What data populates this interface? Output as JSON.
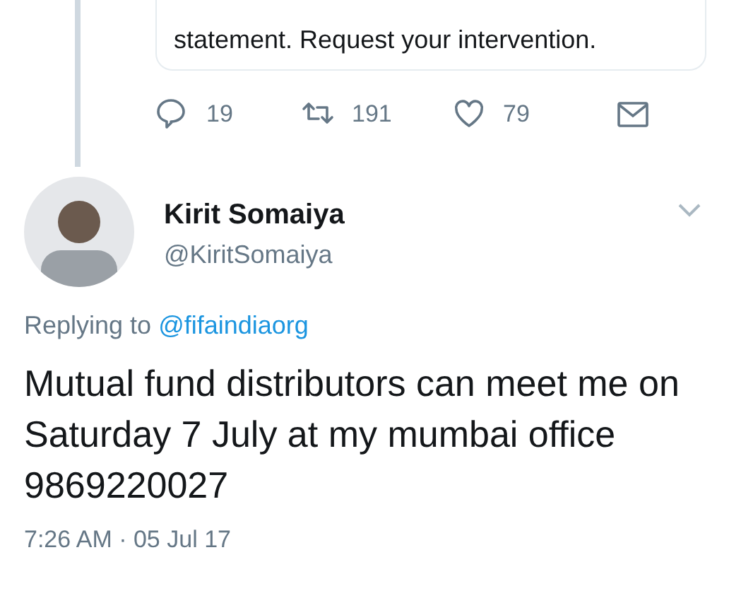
{
  "quoted_tweet": {
    "text": "statement. Request your intervention."
  },
  "actions": [
    {
      "kind": "reply",
      "count": "19"
    },
    {
      "kind": "retweet",
      "count": "191"
    },
    {
      "kind": "like",
      "count": "79"
    },
    {
      "kind": "message"
    }
  ],
  "tweet": {
    "name": "Kirit Somaiya",
    "handle": "@KiritSomaiya",
    "replying_label": "Replying to",
    "replying_to": "@fifaindiaorg",
    "text": "Mutual fund distributors can meet me on Saturday 7 July at my mumbai office 9869220027",
    "time": "7:26 AM · 05 Jul 17"
  }
}
